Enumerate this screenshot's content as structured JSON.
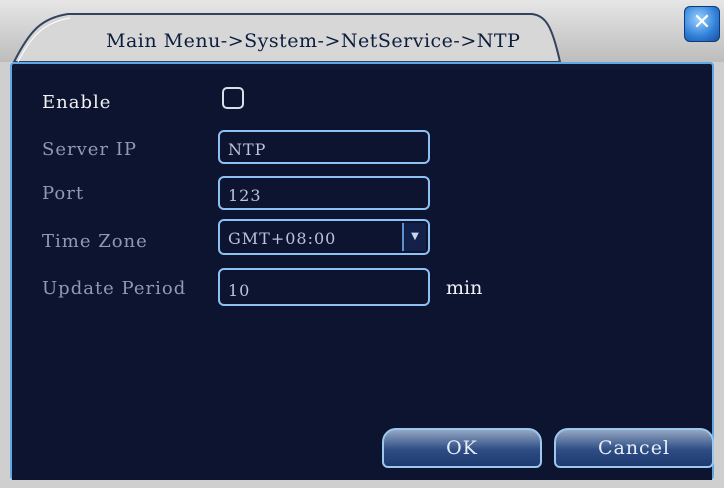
{
  "window": {
    "title": "Main Menu->System->NetService->NTP",
    "close_icon": "close-icon"
  },
  "form": {
    "enable_label": "Enable",
    "enable_checked": false,
    "server_ip_label": "Server IP",
    "server_ip_value": "NTP",
    "port_label": "Port",
    "port_value": "123",
    "time_zone_label": "Time Zone",
    "time_zone_value": "GMT+08:00",
    "dropdown_icon": "chevron-down-icon",
    "update_period_label": "Update Period",
    "update_period_value": "10",
    "update_period_unit": "min"
  },
  "buttons": {
    "ok_label": "OK",
    "cancel_label": "Cancel"
  },
  "colors": {
    "panel_background": "#0c1430",
    "panel_border": "#5ea8e8",
    "inactive_label": "#8f9bb3",
    "active_label": "#f2f2f2"
  }
}
